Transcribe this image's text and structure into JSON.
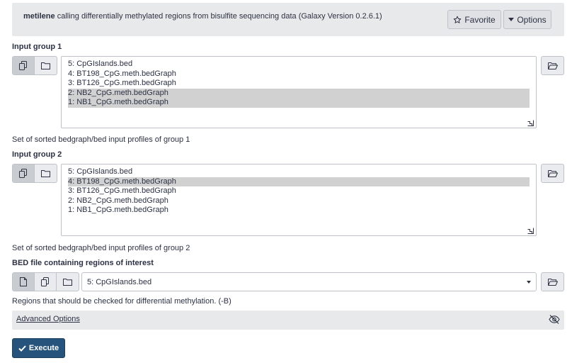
{
  "header": {
    "tool_name": "metilene",
    "description": "calling differentially methylated regions from bisulfite sequencing data (Galaxy Version 0.2.6.1)",
    "favorite_label": "Favorite",
    "options_label": "Options"
  },
  "group1": {
    "label": "Input group 1",
    "items": [
      {
        "label": "5: CpGIslands.bed",
        "selected": false
      },
      {
        "label": "4: BT198_CpG.meth.bedGraph",
        "selected": false
      },
      {
        "label": "3: BT126_CpG.meth.bedGraph",
        "selected": false
      },
      {
        "label": "2: NB2_CpG.meth.bedGraph",
        "selected": true
      },
      {
        "label": "1: NB1_CpG.meth.bedGraph",
        "selected": true
      }
    ],
    "help": "Set of sorted bedgraph/bed input profiles of group 1"
  },
  "group2": {
    "label": "Input group 2",
    "items": [
      {
        "label": "5: CpGIslands.bed",
        "selected": false
      },
      {
        "label": "4: BT198_CpG.meth.bedGraph",
        "selected": true
      },
      {
        "label": "3: BT126_CpG.meth.bedGraph",
        "selected": false
      },
      {
        "label": "2: NB2_CpG.meth.bedGraph",
        "selected": false
      },
      {
        "label": "1: NB1_CpG.meth.bedGraph",
        "selected": false
      }
    ],
    "help": "Set of sorted bedgraph/bed input profiles of group 2"
  },
  "bed": {
    "label": "BED file containing regions of interest",
    "selected_value": "5: CpGIslands.bed",
    "help": "Regions that should be checked for differential methylation. (-B)"
  },
  "advanced": {
    "label": "Advanced Options"
  },
  "execute_label": "Execute",
  "colors": {
    "execute": "#25537b",
    "selected_row": "#d1d1d1",
    "header_bg": "#e8e9ea"
  }
}
